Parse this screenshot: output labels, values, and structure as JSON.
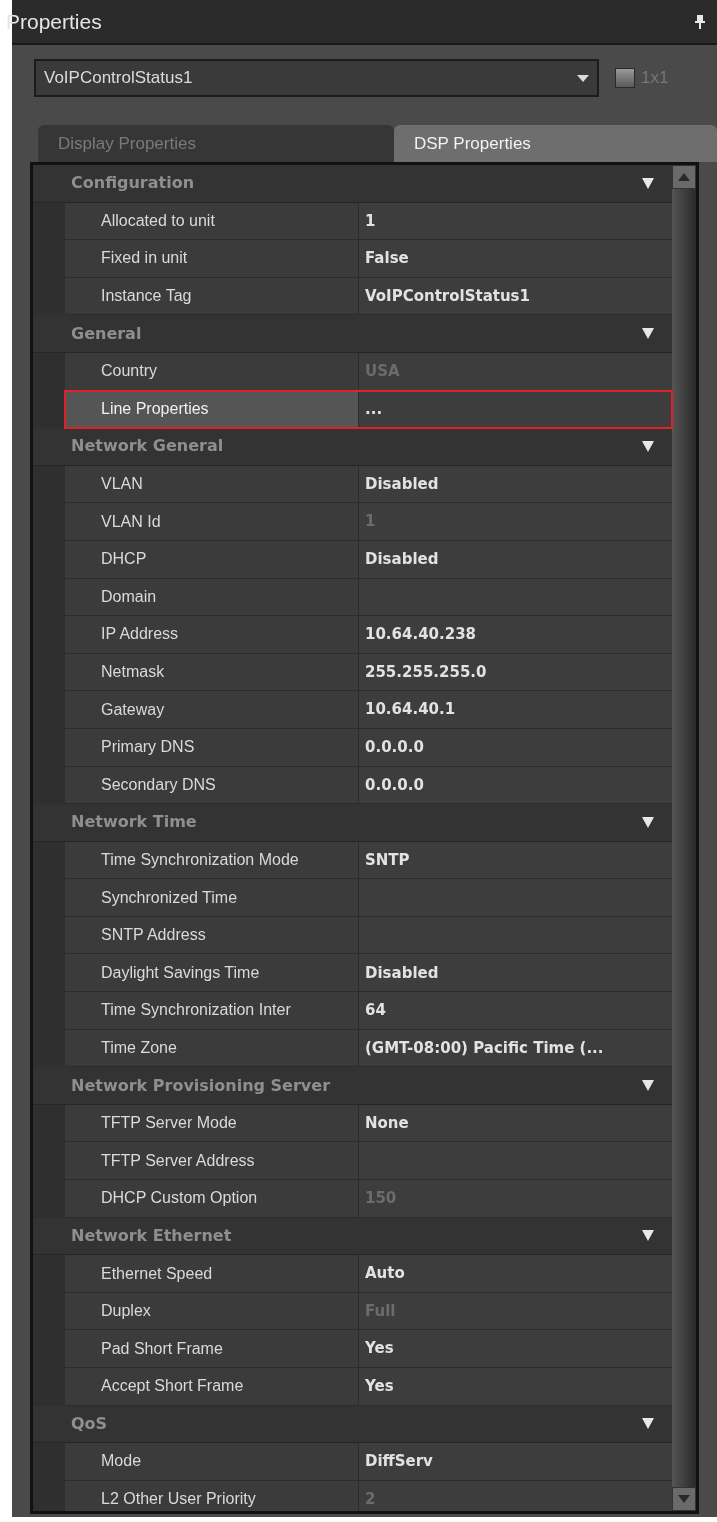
{
  "panel": {
    "title": "Properties"
  },
  "selector": {
    "value": "VoIPControlStatus1",
    "checkbox_label": "1x1",
    "checked": false
  },
  "tabs": [
    {
      "label": "Display Properties",
      "selected": false
    },
    {
      "label": "DSP Properties",
      "selected": true
    }
  ],
  "sections": [
    {
      "title": "Configuration",
      "expanded": true,
      "rows": [
        {
          "label": "Allocated to unit",
          "value": "1",
          "disabled": false,
          "selected": false
        },
        {
          "label": "Fixed in unit",
          "value": "False",
          "disabled": false,
          "selected": false
        },
        {
          "label": "Instance Tag",
          "value": "VoIPControlStatus1",
          "disabled": false,
          "selected": false
        }
      ]
    },
    {
      "title": "General",
      "expanded": true,
      "rows": [
        {
          "label": "Country",
          "value": "USA",
          "disabled": true,
          "selected": false
        },
        {
          "label": "Line Properties",
          "value": "...",
          "disabled": false,
          "selected": true
        }
      ]
    },
    {
      "title": "Network General",
      "expanded": true,
      "rows": [
        {
          "label": "VLAN",
          "value": "Disabled",
          "disabled": false,
          "selected": false
        },
        {
          "label": "VLAN Id",
          "value": "1",
          "disabled": true,
          "selected": false
        },
        {
          "label": "DHCP",
          "value": "Disabled",
          "disabled": false,
          "selected": false
        },
        {
          "label": "Domain",
          "disabled": false,
          "selected": false
        },
        {
          "label": "IP Address",
          "value": "10.64.40.238",
          "disabled": false,
          "selected": false
        },
        {
          "label": "Netmask",
          "value": "255.255.255.0",
          "disabled": false,
          "selected": false
        },
        {
          "label": "Gateway",
          "value": "10.64.40.1",
          "disabled": false,
          "selected": false
        },
        {
          "label": "Primary DNS",
          "value": "0.0.0.0",
          "disabled": false,
          "selected": false
        },
        {
          "label": "Secondary DNS",
          "value": "0.0.0.0",
          "disabled": false,
          "selected": false
        }
      ]
    },
    {
      "title": "Network Time",
      "expanded": true,
      "rows": [
        {
          "label": "Time Synchronization Mode",
          "value": "SNTP",
          "disabled": false,
          "selected": false
        },
        {
          "label": "Synchronized Time",
          "disabled": false,
          "selected": false
        },
        {
          "label": "SNTP Address",
          "disabled": false,
          "selected": false
        },
        {
          "label": "Daylight Savings Time",
          "value": "Disabled",
          "disabled": false,
          "selected": false
        },
        {
          "label": "Time Synchronization Inter",
          "value": "64",
          "disabled": false,
          "selected": false
        },
        {
          "label": "Time Zone",
          "value": "(GMT-08:00) Pacific Time (...",
          "disabled": false,
          "selected": false
        }
      ]
    },
    {
      "title": "Network Provisioning Server",
      "expanded": true,
      "rows": [
        {
          "label": "TFTP Server Mode",
          "value": "None",
          "disabled": false,
          "selected": false
        },
        {
          "label": "TFTP Server Address",
          "disabled": false,
          "selected": false
        },
        {
          "label": "DHCP Custom Option",
          "value": "150",
          "disabled": true,
          "selected": false
        }
      ]
    },
    {
      "title": "Network Ethernet",
      "expanded": true,
      "rows": [
        {
          "label": "Ethernet Speed",
          "value": "Auto",
          "disabled": false,
          "selected": false
        },
        {
          "label": "Duplex",
          "value": "Full",
          "disabled": true,
          "selected": false
        },
        {
          "label": "Pad Short Frame",
          "value": "Yes",
          "disabled": false,
          "selected": false
        },
        {
          "label": "Accept Short Frame",
          "value": "Yes",
          "disabled": false,
          "selected": false
        }
      ]
    },
    {
      "title": "QoS",
      "expanded": true,
      "rows": [
        {
          "label": "Mode",
          "value": "DiffServ",
          "disabled": false,
          "selected": false
        },
        {
          "label": "L2 Other User Priority",
          "value": "2",
          "disabled": true,
          "selected": false
        }
      ]
    }
  ]
}
